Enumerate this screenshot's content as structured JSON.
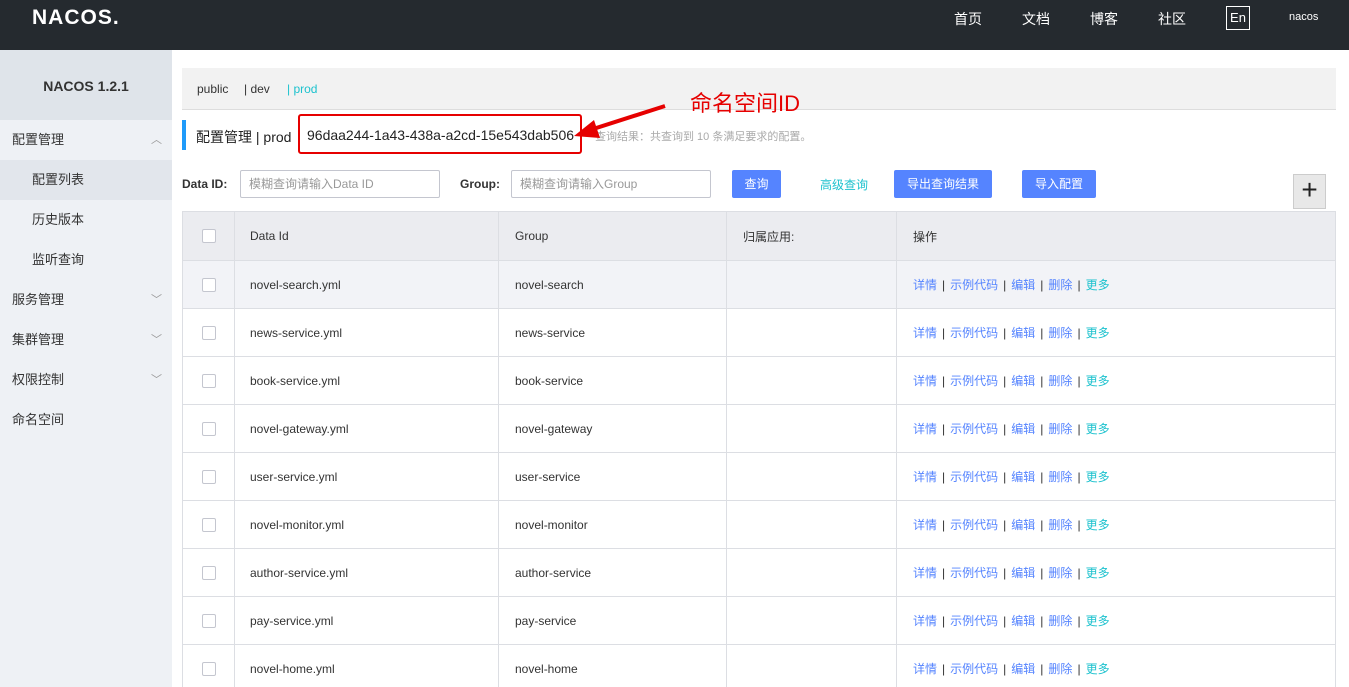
{
  "nav": {
    "logo": "NACOS.",
    "links": [
      "首页",
      "文档",
      "博客",
      "社区"
    ],
    "lang": "En",
    "user": "nacos"
  },
  "sidebar": {
    "title": "NACOS 1.2.1",
    "items": [
      {
        "label": "配置管理",
        "expanded": true
      },
      {
        "label": "配置列表",
        "sub": true,
        "active": true
      },
      {
        "label": "历史版本",
        "sub": true
      },
      {
        "label": "监听查询",
        "sub": true
      },
      {
        "label": "服务管理",
        "expanded": false
      },
      {
        "label": "集群管理",
        "expanded": false
      },
      {
        "label": "权限控制",
        "expanded": false
      },
      {
        "label": "命名空间"
      }
    ]
  },
  "namespaces": [
    "public",
    "| dev",
    "| prod"
  ],
  "header": {
    "title": "配置管理 | prod",
    "namespace_id": "96daa244-1a43-438a-a2cd-15e543dab506",
    "query_result": "查询结果：共查询到 10 条满足要求的配置。",
    "annotation": "命名空间ID"
  },
  "filters": {
    "data_id_label": "Data ID:",
    "data_id_placeholder": "模糊查询请输入Data ID",
    "group_label": "Group:",
    "group_placeholder": "模糊查询请输入Group",
    "search_button": "查询",
    "advanced_query": "高级查询",
    "export_button": "导出查询结果",
    "import_button": "导入配置",
    "add_button": "+"
  },
  "table": {
    "columns": [
      "Data Id",
      "Group",
      "归属应用:",
      "操作"
    ],
    "rows": [
      {
        "data_id": "novel-search.yml",
        "group": "novel-search",
        "app": ""
      },
      {
        "data_id": "news-service.yml",
        "group": "news-service",
        "app": ""
      },
      {
        "data_id": "book-service.yml",
        "group": "book-service",
        "app": ""
      },
      {
        "data_id": "novel-gateway.yml",
        "group": "novel-gateway",
        "app": ""
      },
      {
        "data_id": "user-service.yml",
        "group": "user-service",
        "app": ""
      },
      {
        "data_id": "novel-monitor.yml",
        "group": "novel-monitor",
        "app": ""
      },
      {
        "data_id": "author-service.yml",
        "group": "author-service",
        "app": ""
      },
      {
        "data_id": "pay-service.yml",
        "group": "pay-service",
        "app": ""
      },
      {
        "data_id": "novel-home.yml",
        "group": "novel-home",
        "app": ""
      }
    ],
    "ops": {
      "details": "详情",
      "sample": "示例代码",
      "edit": "编辑",
      "delete": "删除",
      "more": "更多"
    }
  },
  "colors": {
    "nav_bg": "#252a2f",
    "primary": "#5584ff",
    "teal": "#1dc2ce",
    "annotation_red": "#e60000"
  }
}
